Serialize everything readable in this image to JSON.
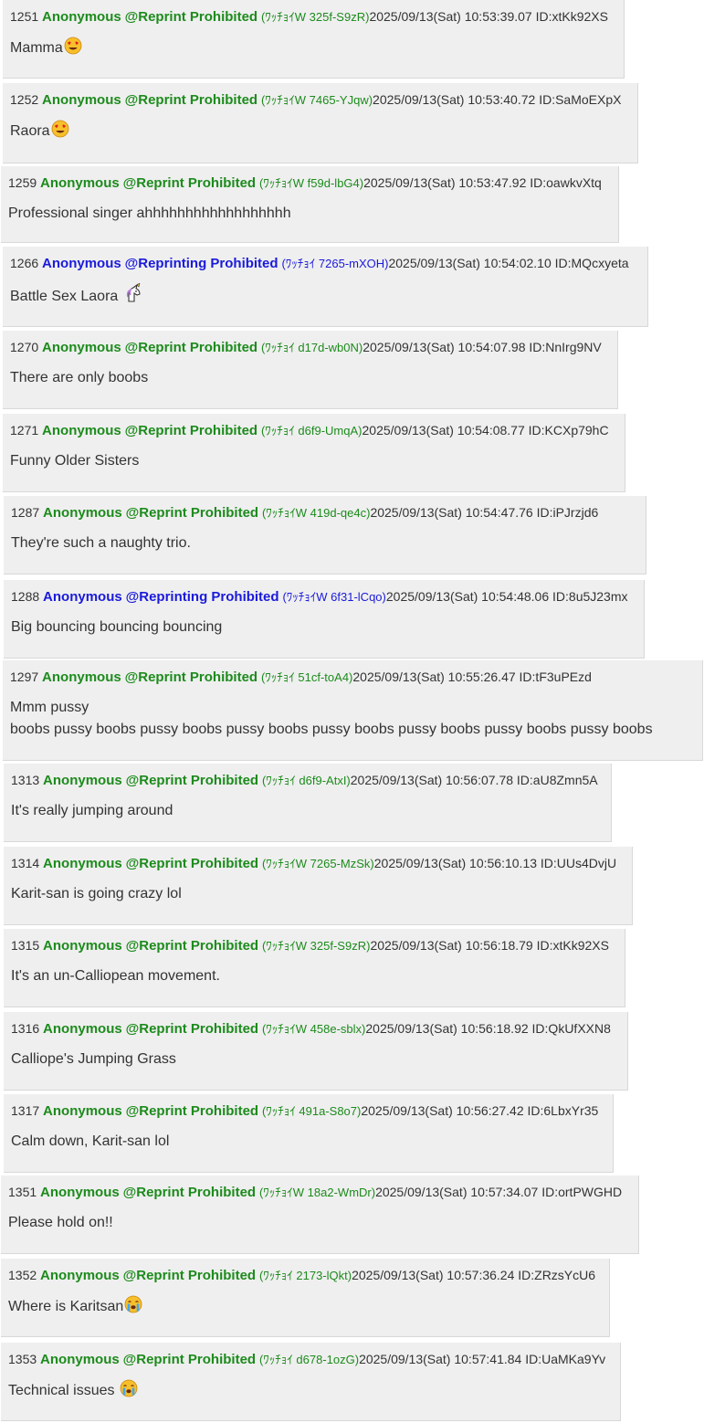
{
  "posts": [
    {
      "num": "1251",
      "name": "Anonymous",
      "trip": "@Reprint Prohibited",
      "hash": "(ﾜｯﾁｮｲW 325f-S9zR)",
      "meta": "2025/09/13(Sat) 10:53:39.07 ID:xtKk92XS",
      "color": "green",
      "lines": [
        "Mamma"
      ],
      "emoji": "heart-eyes"
    },
    {
      "num": "1252",
      "name": "Anonymous",
      "trip": "@Reprint Prohibited",
      "hash": "(ﾜｯﾁｮｲW 7465-YJqw)",
      "meta": "2025/09/13(Sat) 10:53:40.72 ID:SaMoEXpX",
      "color": "green",
      "lines": [
        "Raora"
      ],
      "emoji": "heart-eyes"
    },
    {
      "num": "1259",
      "name": "Anonymous",
      "trip": "@Reprint Prohibited",
      "hash": "(ﾜｯﾁｮｲW f59d-lbG4)",
      "meta": "2025/09/13(Sat) 10:53:47.92 ID:oawkvXtq",
      "color": "green",
      "lines": [
        "Professional singer ahhhhhhhhhhhhhhhhhh"
      ]
    },
    {
      "num": "1266",
      "name": "Anonymous",
      "trip": "@Reprinting Prohibited",
      "hash": "(ﾜｯﾁｮｲ 7265-mXOH)",
      "meta": "2025/09/13(Sat) 10:54:02.10 ID:MQcxyeta",
      "color": "blue",
      "lines": [
        "Battle Sex Laora "
      ],
      "emoji": "unicorn"
    },
    {
      "num": "1270",
      "name": "Anonymous",
      "trip": "@Reprint Prohibited",
      "hash": "(ﾜｯﾁｮｲ d17d-wb0N)",
      "meta": "2025/09/13(Sat) 10:54:07.98 ID:NnIrg9NV",
      "color": "green",
      "lines": [
        "There are only boobs"
      ]
    },
    {
      "num": "1271",
      "name": "Anonymous",
      "trip": "@Reprint Prohibited",
      "hash": "(ﾜｯﾁｮｲ d6f9-UmqA)",
      "meta": "2025/09/13(Sat) 10:54:08.77 ID:KCXp79hC",
      "color": "green",
      "lines": [
        "Funny Older Sisters"
      ]
    },
    {
      "num": "1287",
      "name": "Anonymous",
      "trip": "@Reprint Prohibited",
      "hash": "(ﾜｯﾁｮｲW 419d-qe4c)",
      "meta": "2025/09/13(Sat) 10:54:47.76 ID:iPJrzjd6",
      "color": "green",
      "lines": [
        "They're such a naughty trio."
      ]
    },
    {
      "num": "1288",
      "name": "Anonymous",
      "trip": "@Reprinting Prohibited",
      "hash": "(ﾜｯﾁｮｲW 6f31-lCqo)",
      "meta": "2025/09/13(Sat) 10:54:48.06 ID:8u5J23mx",
      "color": "blue",
      "lines": [
        "Big bouncing bouncing bouncing"
      ]
    },
    {
      "num": "1297",
      "name": "Anonymous",
      "trip": "@Reprint Prohibited",
      "hash": "(ﾜｯﾁｮｲ 51cf-toA4)",
      "meta": "2025/09/13(Sat) 10:55:26.47 ID:tF3uPEzd",
      "color": "green",
      "lines": [
        "Mmm pussy",
        "boobs pussy boobs pussy boobs pussy boobs pussy boobs pussy boobs pussy boobs pussy boobs"
      ]
    },
    {
      "num": "1313",
      "name": "Anonymous",
      "trip": "@Reprint Prohibited",
      "hash": "(ﾜｯﾁｮｲ d6f9-AtxI)",
      "meta": "2025/09/13(Sat) 10:56:07.78 ID:aU8Zmn5A",
      "color": "green",
      "lines": [
        "It's really jumping around"
      ]
    },
    {
      "num": "1314",
      "name": "Anonymous",
      "trip": "@Reprint Prohibited",
      "hash": "(ﾜｯﾁｮｲW 7265-MzSk)",
      "meta": "2025/09/13(Sat) 10:56:10.13 ID:UUs4DvjU",
      "color": "green",
      "lines": [
        "Karit-san is going crazy lol"
      ]
    },
    {
      "num": "1315",
      "name": "Anonymous",
      "trip": "@Reprint Prohibited",
      "hash": "(ﾜｯﾁｮｲW 325f-S9zR)",
      "meta": "2025/09/13(Sat) 10:56:18.79 ID:xtKk92XS",
      "color": "green",
      "lines": [
        "It's an un-Calliopean movement."
      ]
    },
    {
      "num": "1316",
      "name": "Anonymous",
      "trip": "@Reprint Prohibited",
      "hash": "(ﾜｯﾁｮｲW 458e-sblx)",
      "meta": "2025/09/13(Sat) 10:56:18.92 ID:QkUfXXN8",
      "color": "green",
      "lines": [
        "Calliope's Jumping Grass"
      ]
    },
    {
      "num": "1317",
      "name": "Anonymous",
      "trip": "@Reprint Prohibited",
      "hash": "(ﾜｯﾁｮｲ 491a-S8o7)",
      "meta": "2025/09/13(Sat) 10:56:27.42 ID:6LbxYr35",
      "color": "green",
      "lines": [
        "Calm down, Karit-san lol"
      ]
    },
    {
      "num": "1351",
      "name": "Anonymous",
      "trip": "@Reprint Prohibited",
      "hash": "(ﾜｯﾁｮｲW 18a2-WmDr)",
      "meta": "2025/09/13(Sat) 10:57:34.07 ID:ortPWGHD",
      "color": "green",
      "lines": [
        "Please hold on!!"
      ]
    },
    {
      "num": "1352",
      "name": "Anonymous",
      "trip": "@Reprint Prohibited",
      "hash": "(ﾜｯﾁｮｲ 2173-lQkt)",
      "meta": "2025/09/13(Sat) 10:57:36.24 ID:ZRzsYcU6",
      "color": "green",
      "lines": [
        "Where is Karitsan"
      ],
      "emoji": "crying"
    },
    {
      "num": "1353",
      "name": "Anonymous",
      "trip": "@Reprint Prohibited",
      "hash": "(ﾜｯﾁｮｲ d678-1ozG)",
      "meta": "2025/09/13(Sat) 10:57:41.84 ID:UaMKa9Yv",
      "color": "green",
      "lines": [
        "Technical issues "
      ],
      "emoji": "crying"
    }
  ]
}
